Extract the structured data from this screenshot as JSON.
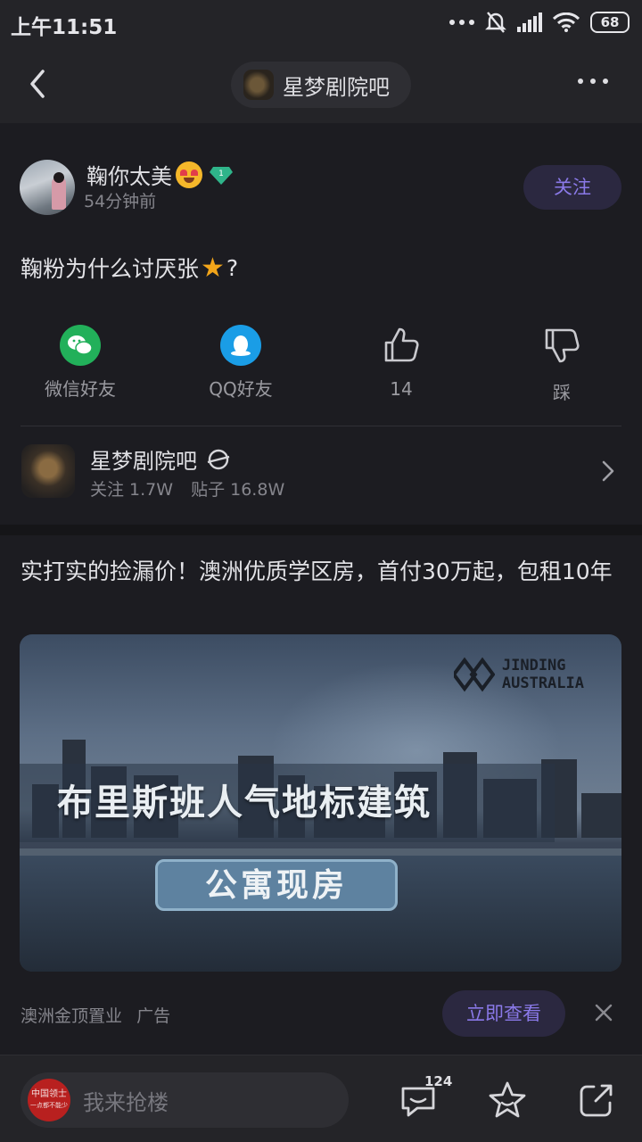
{
  "status_bar": {
    "time": "上午11:51",
    "battery": "68"
  },
  "navbar": {
    "forum_name": "星梦剧院吧"
  },
  "post": {
    "author": "鞠你太美",
    "time": "54分钟前",
    "follow_label": "关注",
    "title_before": "鞠粉为什么讨厌张",
    "title_emoji": "★",
    "title_after": "?",
    "share": {
      "wechat": "微信好友",
      "qq": "QQ好友",
      "like_count": "14",
      "dislike": "踩"
    },
    "forum": {
      "name": "星梦剧院吧",
      "followers": "关注 1.7W",
      "posts": "贴子 16.8W"
    }
  },
  "ad": {
    "title": "实打实的捡漏价！澳洲优质学区房，首付30万起，包租10年",
    "headline": "布里斯班人气地标建筑",
    "sub_badge": "公寓现房",
    "brand_line1": "JINDING",
    "brand_line2": "AUSTRALIA",
    "source": "澳洲金顶置业",
    "ad_tag": "广告",
    "cta": "立即查看"
  },
  "bottom_bar": {
    "user_avatar_line1": "中国领士",
    "user_avatar_line2": "一点都不能少",
    "reply_placeholder": "我来抢楼",
    "comment_count": "124"
  },
  "colors": {
    "accent": "#8a79e8",
    "background": "#1c1c21",
    "bar": "#242428"
  }
}
